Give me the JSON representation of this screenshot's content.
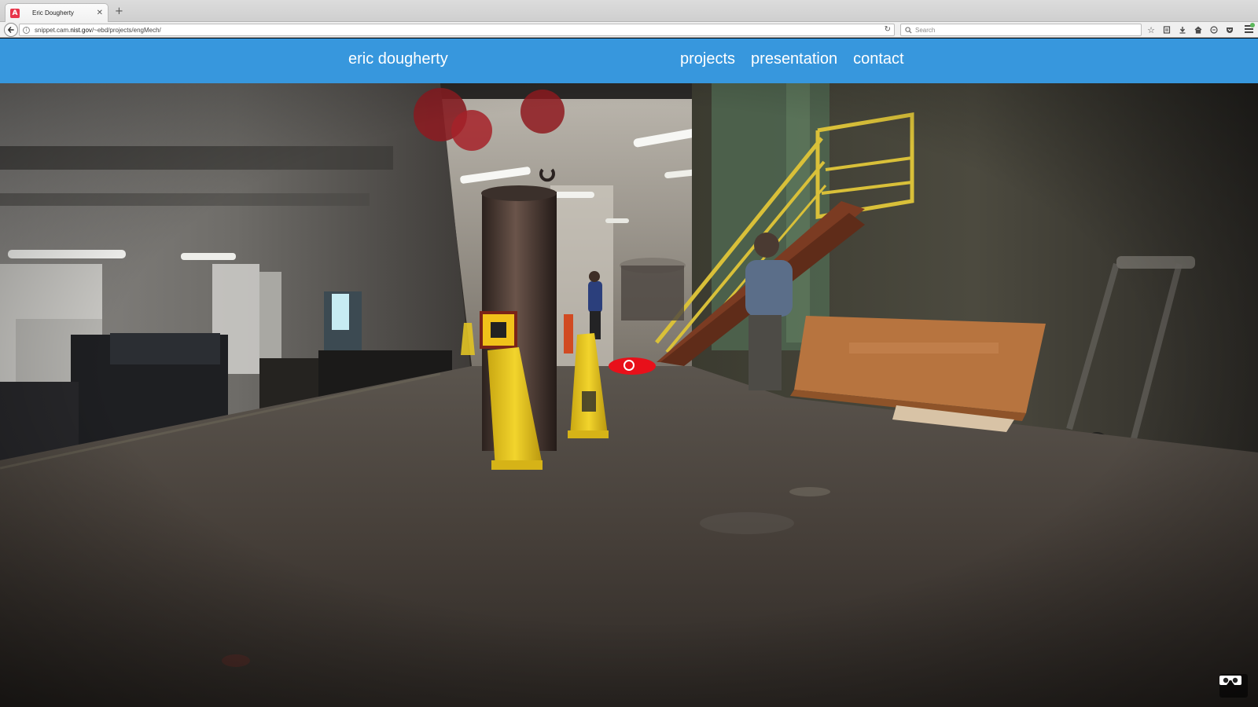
{
  "browser": {
    "tab": {
      "title": "Eric Dougherty",
      "favicon_letter": "A",
      "favicon_color": "#e8344a"
    },
    "url": {
      "prefix": "snippet.cam.",
      "domain": "nist.gov",
      "path": "/~ebd/projects/engMech/"
    },
    "search": {
      "placeholder": "Search"
    },
    "toolbar_icons": [
      "bookmark-star-icon",
      "reading-list-icon",
      "download-icon",
      "home-icon",
      "chat-icon",
      "pocket-icon",
      "menu-icon"
    ]
  },
  "site": {
    "name": "eric dougherty",
    "nav": {
      "projects": "projects",
      "presentation": "presentation",
      "contact": "contact"
    },
    "header_color": "#3797dd"
  },
  "viewer": {
    "scene": "360-degree panorama of an industrial engineering lab with yellow safety cones, a central column, and a yellow staircase",
    "hotspot_color": "#e8101a",
    "vr_button_icon": "cardboard-vr-icon"
  }
}
